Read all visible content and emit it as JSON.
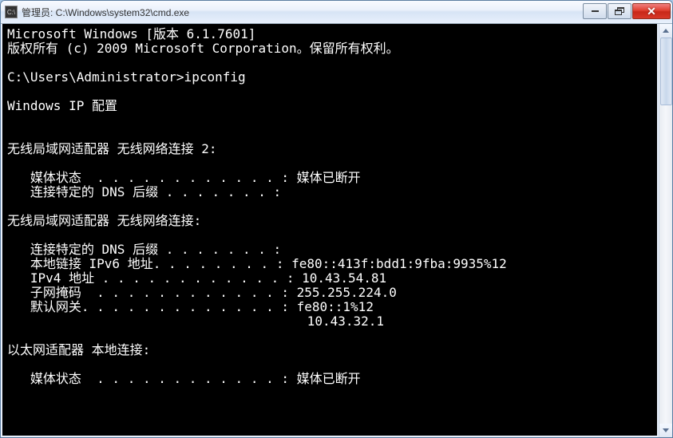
{
  "window": {
    "title": "管理员: C:\\Windows\\system32\\cmd.exe"
  },
  "terminal": {
    "lines": [
      "Microsoft Windows [版本 6.1.7601]",
      "版权所有 (c) 2009 Microsoft Corporation。保留所有权利。",
      "",
      "C:\\Users\\Administrator>ipconfig",
      "",
      "Windows IP 配置",
      "",
      "",
      "无线局域网适配器 无线网络连接 2:",
      "",
      "   媒体状态  . . . . . . . . . . . . : 媒体已断开",
      "   连接特定的 DNS 后缀 . . . . . . . :",
      "",
      "无线局域网适配器 无线网络连接:",
      "",
      "   连接特定的 DNS 后缀 . . . . . . . :",
      "   本地链接 IPv6 地址. . . . . . . . : fe80::413f:bdd1:9fba:9935%12",
      "   IPv4 地址 . . . . . . . . . . . . : 10.43.54.81",
      "   子网掩码  . . . . . . . . . . . . : 255.255.224.0",
      "   默认网关. . . . . . . . . . . . . : fe80::1%12",
      "                                       10.43.32.1",
      "",
      "以太网适配器 本地连接:",
      "",
      "   媒体状态  . . . . . . . . . . . . : 媒体已断开"
    ]
  }
}
